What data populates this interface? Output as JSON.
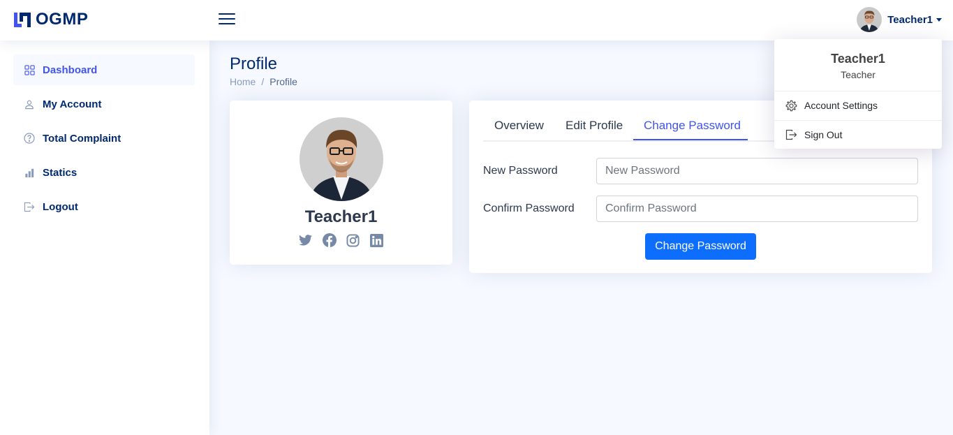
{
  "header": {
    "logo_text": "OGMP",
    "user_name": "Teacher1"
  },
  "sidebar": {
    "items": [
      {
        "label": "Dashboard",
        "icon": "grid-icon",
        "active": true
      },
      {
        "label": "My Account",
        "icon": "person-icon"
      },
      {
        "label": "Total Complaint",
        "icon": "question-circle-icon"
      },
      {
        "label": "Statics",
        "icon": "bar-chart-icon"
      },
      {
        "label": "Logout",
        "icon": "box-arrow-right-icon"
      }
    ]
  },
  "page": {
    "title": "Profile",
    "breadcrumb": [
      "Home",
      "/",
      "Profile"
    ]
  },
  "profile_card": {
    "name": "Teacher1",
    "socials": [
      "twitter-icon",
      "facebook-icon",
      "instagram-icon",
      "linkedin-icon"
    ]
  },
  "tabs": {
    "items": [
      "Overview",
      "Edit Profile",
      "Change Password"
    ],
    "active": "Change Password"
  },
  "form": {
    "new_password_label": "New Password",
    "new_password_placeholder": "New Password",
    "confirm_password_label": "Confirm Password",
    "confirm_password_placeholder": "Confirm Password",
    "submit_label": "Change Password"
  },
  "dropdown": {
    "name": "Teacher1",
    "role": "Teacher",
    "items": [
      {
        "label": "Account Settings",
        "icon": "gear-icon"
      },
      {
        "label": "Sign Out",
        "icon": "box-arrow-right-icon"
      }
    ]
  },
  "colors": {
    "primary": "#4154f1",
    "navy": "#012970",
    "button": "#0d6efd",
    "background": "#f6f9ff"
  }
}
